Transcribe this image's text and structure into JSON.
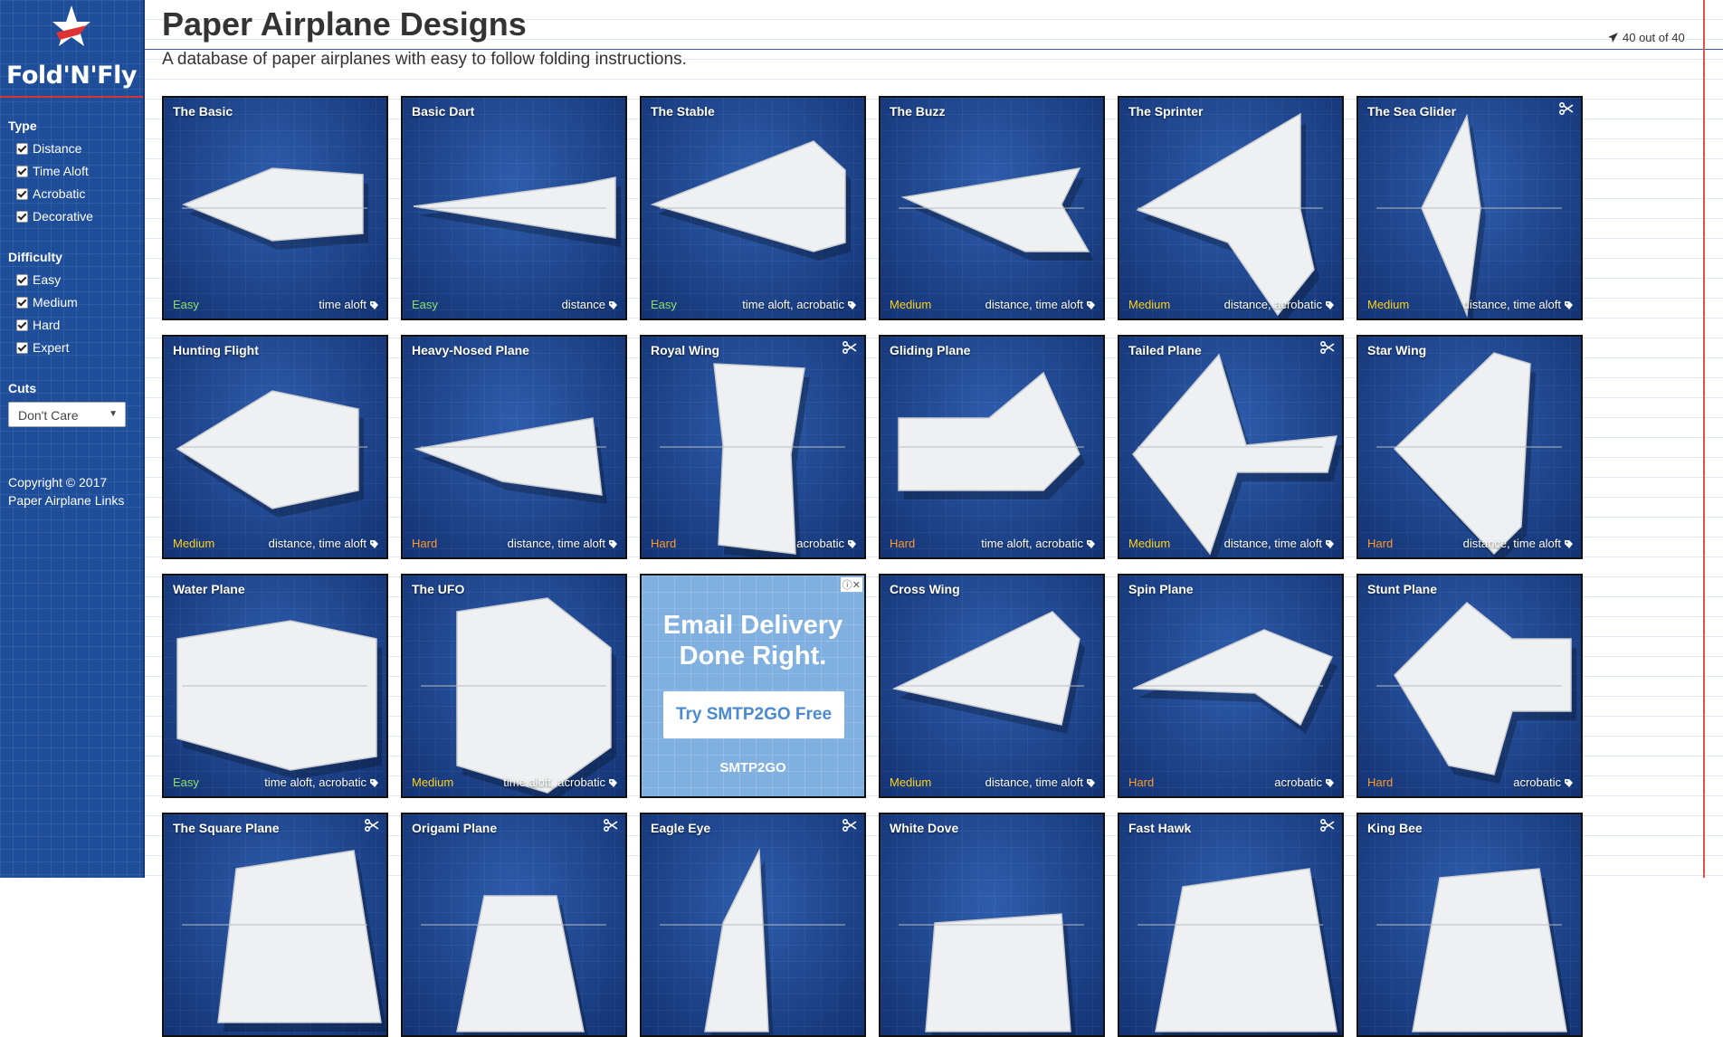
{
  "brand": {
    "logo_text": "Fold'N'Fly"
  },
  "header": {
    "title": "Paper Airplane Designs",
    "subtitle": "A database of paper airplanes with easy to follow folding instructions.",
    "count": "40 out of 40"
  },
  "sidebar": {
    "type_title": "Type",
    "types": [
      "Distance",
      "Time Aloft",
      "Acrobatic",
      "Decorative"
    ],
    "difficulty_title": "Difficulty",
    "difficulties": [
      "Easy",
      "Medium",
      "Hard",
      "Expert"
    ],
    "cuts_title": "Cuts",
    "cuts_value": "Don't Care",
    "copyright_line1": "Copyright © 2017",
    "copyright_line2": "Paper Airplane Links"
  },
  "ad": {
    "title_line1": "Email Delivery",
    "title_line2": "Done Right.",
    "button": "Try SMTP2GO Free",
    "brand": "SMTP2GO"
  },
  "cards": [
    {
      "title": "The Basic",
      "difficulty": "Easy",
      "tags": "time aloft",
      "cuts": false
    },
    {
      "title": "Basic Dart",
      "difficulty": "Easy",
      "tags": "distance",
      "cuts": false
    },
    {
      "title": "The Stable",
      "difficulty": "Easy",
      "tags": "time aloft, acrobatic",
      "cuts": false
    },
    {
      "title": "The Buzz",
      "difficulty": "Medium",
      "tags": "distance, time aloft",
      "cuts": false
    },
    {
      "title": "The Sprinter",
      "difficulty": "Medium",
      "tags": "distance, acrobatic",
      "cuts": false
    },
    {
      "title": "The Sea Glider",
      "difficulty": "Medium",
      "tags": "distance, time aloft",
      "cuts": true
    },
    {
      "title": "Hunting Flight",
      "difficulty": "Medium",
      "tags": "distance, time aloft",
      "cuts": false
    },
    {
      "title": "Heavy-Nosed Plane",
      "difficulty": "Hard",
      "tags": "distance, time aloft",
      "cuts": false
    },
    {
      "title": "Royal Wing",
      "difficulty": "Hard",
      "tags": "acrobatic",
      "cuts": true
    },
    {
      "title": "Gliding Plane",
      "difficulty": "Hard",
      "tags": "time aloft, acrobatic",
      "cuts": false
    },
    {
      "title": "Tailed Plane",
      "difficulty": "Medium",
      "tags": "distance, time aloft",
      "cuts": true
    },
    {
      "title": "Star Wing",
      "difficulty": "Hard",
      "tags": "distance, time aloft",
      "cuts": false
    },
    {
      "title": "Water Plane",
      "difficulty": "Easy",
      "tags": "time aloft, acrobatic",
      "cuts": false
    },
    {
      "title": "The UFO",
      "difficulty": "Medium",
      "tags": "time aloft, acrobatic",
      "cuts": false
    },
    {
      "title": "Cross Wing",
      "difficulty": "Medium",
      "tags": "distance, time aloft",
      "cuts": false
    },
    {
      "title": "Spin Plane",
      "difficulty": "Hard",
      "tags": "acrobatic",
      "cuts": false
    },
    {
      "title": "Stunt Plane",
      "difficulty": "Hard",
      "tags": "acrobatic",
      "cuts": false
    },
    {
      "title": "The Square Plane",
      "difficulty": "",
      "tags": "",
      "cuts": true
    },
    {
      "title": "Origami Plane",
      "difficulty": "",
      "tags": "",
      "cuts": true
    },
    {
      "title": "Eagle Eye",
      "difficulty": "",
      "tags": "",
      "cuts": true
    },
    {
      "title": "White Dove",
      "difficulty": "",
      "tags": "",
      "cuts": false
    },
    {
      "title": "Fast Hawk",
      "difficulty": "",
      "tags": "",
      "cuts": true
    },
    {
      "title": "King Bee",
      "difficulty": "",
      "tags": "",
      "cuts": false
    }
  ]
}
